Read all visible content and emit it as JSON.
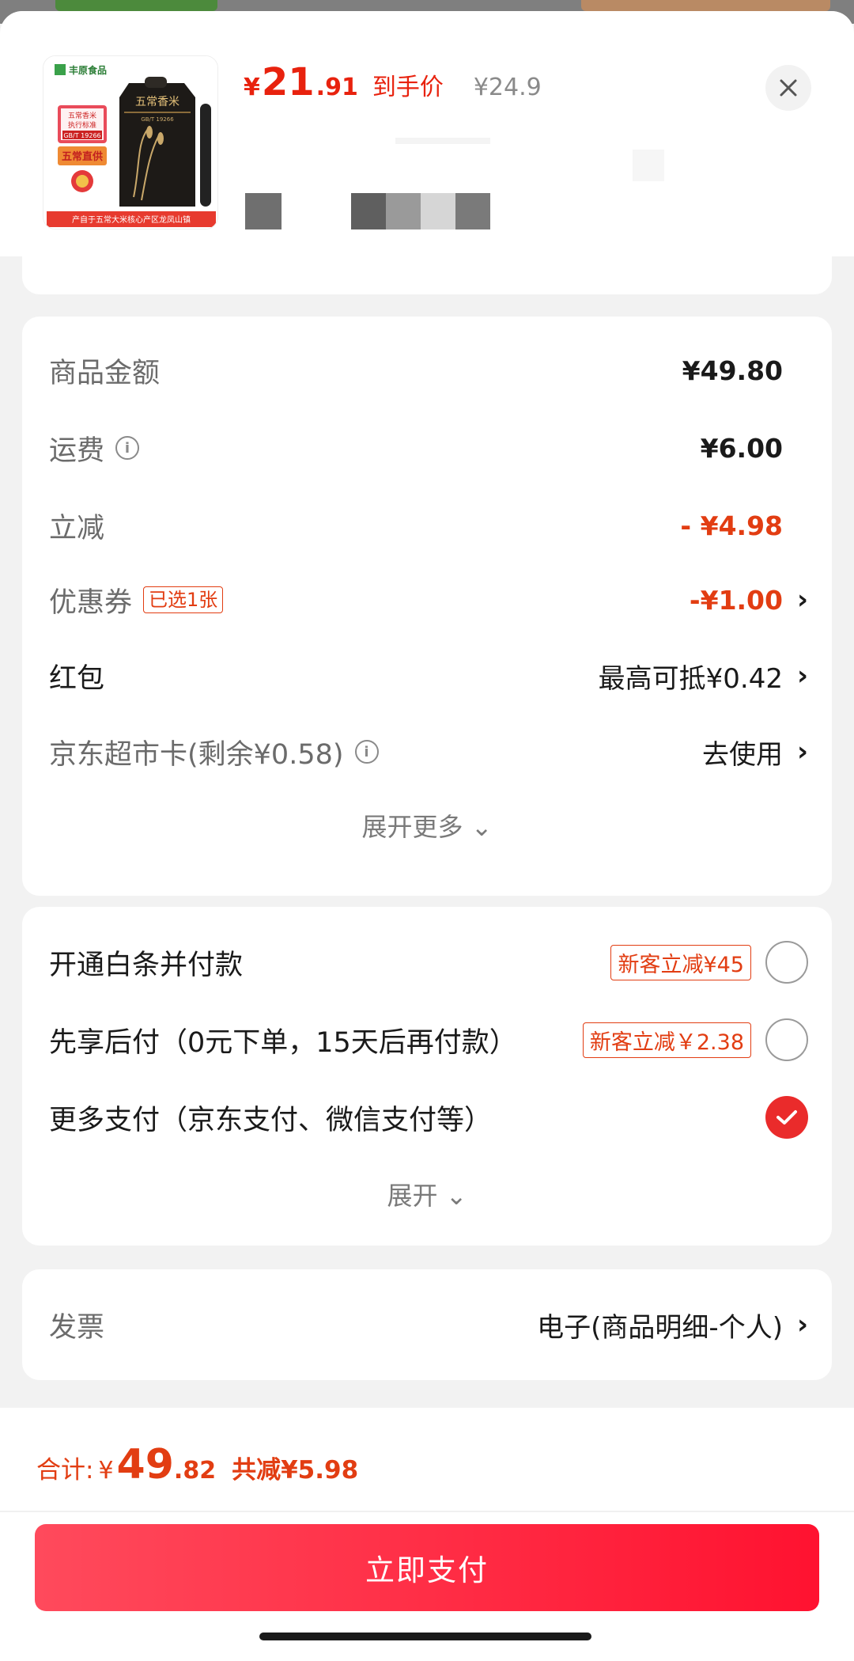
{
  "product": {
    "price_currency": "¥",
    "price_integer": "21",
    "price_decimal": ".91",
    "price_tag": "到手价",
    "original_price": "¥24.9",
    "image_texts": {
      "brand": "丰原食品",
      "rice_name": "五常香米",
      "standard": "GB/T 19266",
      "label_lines": [
        "五常香米",
        "执行标准",
        "GB/T 19266"
      ],
      "direct": "五常直供",
      "origin": "产自于五常大米核心产区龙凤山镇"
    }
  },
  "fees": {
    "rows": [
      {
        "label": "商品金额",
        "value": "¥49.80"
      },
      {
        "label": "运费",
        "value": "¥6.00"
      },
      {
        "label": "立减",
        "value": "- ¥4.98"
      },
      {
        "label": "优惠券",
        "badge": "已选1张",
        "value": "-¥1.00"
      },
      {
        "label": "红包",
        "value": "最高可抵¥0.42"
      },
      {
        "label": "京东超市卡(剩余¥0.58)",
        "value": "去使用"
      }
    ],
    "expand_label": "展开更多"
  },
  "payment": {
    "options": [
      {
        "label": "开通白条并付款",
        "badge": "新客立减¥45",
        "selected": false
      },
      {
        "label": "先享后付（0元下单，15天后再付款）",
        "badge": "新客立减￥2.38",
        "selected": false
      },
      {
        "label": "更多支付（京东支付、微信支付等）",
        "selected": true
      }
    ],
    "expand_label": "展开"
  },
  "invoice": {
    "label": "发票",
    "value": "电子(商品明细-个人)"
  },
  "footer": {
    "total_label": "合计:",
    "total_currency": "¥",
    "total_integer": "49",
    "total_decimal": ".82",
    "savings": "共减¥5.98",
    "pay_button": "立即支付"
  },
  "colors": {
    "accent": "#e23d12",
    "button_start": "#ff4a5c",
    "button_end": "#ff1230"
  },
  "icons": [
    "close-icon",
    "info-icon",
    "chevron-right-icon",
    "chevron-down-icon",
    "check-icon"
  ]
}
